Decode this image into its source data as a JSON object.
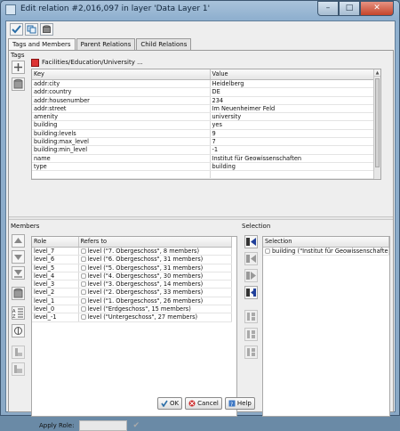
{
  "window": {
    "title": "Edit relation #2,016,097 in layer 'Data Layer 1'"
  },
  "tabs": [
    "Tags and Members",
    "Parent Relations",
    "Child Relations"
  ],
  "tags": {
    "section_label": "Tags",
    "relation_name": "Facilities/Education/University ...",
    "columns": [
      "Key",
      "Value"
    ],
    "rows": [
      [
        "addr:city",
        "Heidelberg"
      ],
      [
        "addr:country",
        "DE"
      ],
      [
        "addr:housenumber",
        "234"
      ],
      [
        "addr:street",
        "Im Neuenheimer Feld"
      ],
      [
        "amenity",
        "university"
      ],
      [
        "building",
        "yes"
      ],
      [
        "building:levels",
        "9"
      ],
      [
        "building:max_level",
        "7"
      ],
      [
        "building:min_level",
        "-1"
      ],
      [
        "name",
        "Institut für Geowissenschaften"
      ],
      [
        "type",
        "building"
      ]
    ]
  },
  "members": {
    "section_label": "Members",
    "columns": [
      "Role",
      "Refers to"
    ],
    "rows": [
      [
        "level_7",
        "level (\"7. Obergeschoss\", 8 members)"
      ],
      [
        "level_6",
        "level (\"6. Obergeschoss\", 31 members)"
      ],
      [
        "level_5",
        "level (\"5. Obergeschoss\", 31 members)"
      ],
      [
        "level_4",
        "level (\"4. Obergeschoss\", 30 members)"
      ],
      [
        "level_3",
        "level (\"3. Obergeschoss\", 14 members)"
      ],
      [
        "level_2",
        "level (\"2. Obergeschoss\", 33 members)"
      ],
      [
        "level_1",
        "level (\"1. Obergeschoss\", 26 members)"
      ],
      [
        "level_0",
        "level (\"Erdgeschoss\", 15 members)"
      ],
      [
        "level_-1",
        "level (\"Untergeschoss\", 27 members)"
      ]
    ],
    "apply_role_label": "Apply Role:"
  },
  "selection": {
    "section_label": "Selection",
    "header": "Selection",
    "item": "building (\"Institut für Geowissenschaften\"..."
  },
  "buttons": {
    "ok": "OK",
    "cancel": "Cancel",
    "help": "Help"
  }
}
